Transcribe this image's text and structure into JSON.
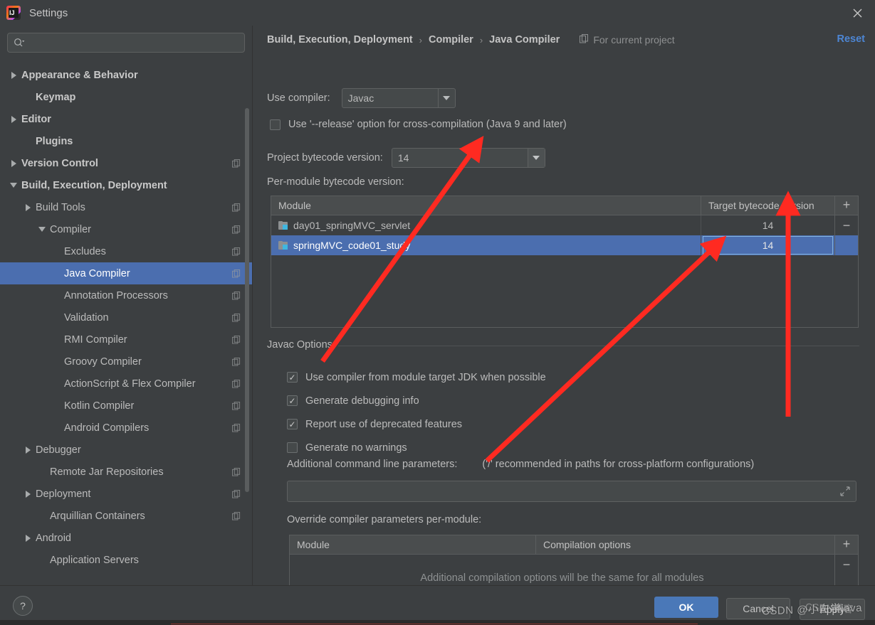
{
  "window": {
    "title": "Settings",
    "logo_icon": "intellij-idea-logo",
    "close_icon": "close-icon"
  },
  "sidebar": {
    "search": {
      "placeholder": "",
      "value": "",
      "icon": "search-icon",
      "dropdown_icon": "chevron-down-icon"
    },
    "items": [
      {
        "label": "Appearance & Behavior",
        "indent": 0,
        "twisty": "collapsed",
        "bold": true,
        "badge": false,
        "selected": false
      },
      {
        "label": "Keymap",
        "indent": 1,
        "twisty": "none",
        "bold": true,
        "badge": false,
        "selected": false
      },
      {
        "label": "Editor",
        "indent": 0,
        "twisty": "collapsed",
        "bold": true,
        "badge": false,
        "selected": false
      },
      {
        "label": "Plugins",
        "indent": 1,
        "twisty": "none",
        "bold": true,
        "badge": false,
        "selected": false
      },
      {
        "label": "Version Control",
        "indent": 0,
        "twisty": "collapsed",
        "bold": true,
        "badge": true,
        "selected": false
      },
      {
        "label": "Build, Execution, Deployment",
        "indent": 0,
        "twisty": "expanded",
        "bold": true,
        "badge": false,
        "selected": false
      },
      {
        "label": "Build Tools",
        "indent": 1,
        "twisty": "collapsed",
        "bold": false,
        "badge": true,
        "selected": false
      },
      {
        "label": "Compiler",
        "indent": 2,
        "twisty": "expanded",
        "bold": false,
        "badge": true,
        "selected": false
      },
      {
        "label": "Excludes",
        "indent": 3,
        "twisty": "none",
        "bold": false,
        "badge": true,
        "selected": false
      },
      {
        "label": "Java Compiler",
        "indent": 3,
        "twisty": "none",
        "bold": false,
        "badge": true,
        "selected": true
      },
      {
        "label": "Annotation Processors",
        "indent": 3,
        "twisty": "none",
        "bold": false,
        "badge": true,
        "selected": false
      },
      {
        "label": "Validation",
        "indent": 3,
        "twisty": "none",
        "bold": false,
        "badge": true,
        "selected": false
      },
      {
        "label": "RMI Compiler",
        "indent": 3,
        "twisty": "none",
        "bold": false,
        "badge": true,
        "selected": false
      },
      {
        "label": "Groovy Compiler",
        "indent": 3,
        "twisty": "none",
        "bold": false,
        "badge": true,
        "selected": false
      },
      {
        "label": "ActionScript & Flex Compiler",
        "indent": 3,
        "twisty": "none",
        "bold": false,
        "badge": true,
        "selected": false
      },
      {
        "label": "Kotlin Compiler",
        "indent": 3,
        "twisty": "none",
        "bold": false,
        "badge": true,
        "selected": false
      },
      {
        "label": "Android Compilers",
        "indent": 3,
        "twisty": "none",
        "bold": false,
        "badge": true,
        "selected": false
      },
      {
        "label": "Debugger",
        "indent": 1,
        "twisty": "collapsed",
        "bold": false,
        "badge": false,
        "selected": false
      },
      {
        "label": "Remote Jar Repositories",
        "indent": 2,
        "twisty": "none",
        "bold": false,
        "badge": true,
        "selected": false
      },
      {
        "label": "Deployment",
        "indent": 1,
        "twisty": "collapsed",
        "bold": false,
        "badge": true,
        "selected": false
      },
      {
        "label": "Arquillian Containers",
        "indent": 2,
        "twisty": "none",
        "bold": false,
        "badge": true,
        "selected": false
      },
      {
        "label": "Android",
        "indent": 1,
        "twisty": "collapsed",
        "bold": false,
        "badge": false,
        "selected": false
      },
      {
        "label": "Application Servers",
        "indent": 2,
        "twisty": "none",
        "bold": false,
        "badge": false,
        "selected": false
      }
    ]
  },
  "main": {
    "breadcrumb": [
      "Build, Execution, Deployment",
      "Compiler",
      "Java Compiler"
    ],
    "breadcrumb_separator": "›",
    "for_current_project": "For current project",
    "for_current_project_icon": "copy-icon",
    "reset_label": "Reset",
    "use_compiler_label": "Use compiler:",
    "use_compiler_value": "Javac",
    "release_option_label": "Use '--release' option for cross-compilation (Java 9 and later)",
    "release_option_checked": false,
    "project_bytecode_label": "Project bytecode version:",
    "project_bytecode_value": "14",
    "per_module_label": "Per-module bytecode version:",
    "module_table": {
      "columns": [
        "Module",
        "Target bytecode version"
      ],
      "add_icon": "plus-icon",
      "remove_icon": "minus-icon",
      "rows": [
        {
          "module": "day01_springMVC_servlet",
          "version": "14",
          "selected": false,
          "editing": false
        },
        {
          "module": "springMVC_code01_study",
          "version": "14",
          "selected": true,
          "editing": true
        }
      ]
    },
    "javac_options_title": "Javac Options",
    "javac_options": [
      {
        "label": "Use compiler from module target JDK when possible",
        "checked": true
      },
      {
        "label": "Generate debugging info",
        "checked": true
      },
      {
        "label": "Report use of deprecated features",
        "checked": true
      },
      {
        "label": "Generate no warnings",
        "checked": false
      }
    ],
    "additional_params_label": "Additional command line parameters:",
    "additional_params_hint": "('/' recommended in paths for cross-platform configurations)",
    "additional_params_value": "",
    "expand_icon": "expand-icon",
    "override_label": "Override compiler parameters per-module:",
    "override_table": {
      "columns": [
        "Module",
        "Compilation options"
      ],
      "empty_message": "Additional compilation options will be the same for all modules",
      "add_icon": "plus-icon",
      "remove_icon": "minus-icon"
    }
  },
  "footer": {
    "help_icon": "help-icon",
    "ok_label": "OK",
    "cancel_label": "Cancel",
    "apply_label": "Apply"
  },
  "annotations": {
    "arrow_color": "#ff2a21",
    "watermark": "CSDN @小白学java",
    "watermark_alt": "CSDN博客"
  },
  "colors": {
    "background": "#3c3f41",
    "selection": "#4b6eaf",
    "accent_link": "#4d86d4",
    "primary_button": "#4a78b8",
    "arrow_red": "#ff2a21"
  }
}
